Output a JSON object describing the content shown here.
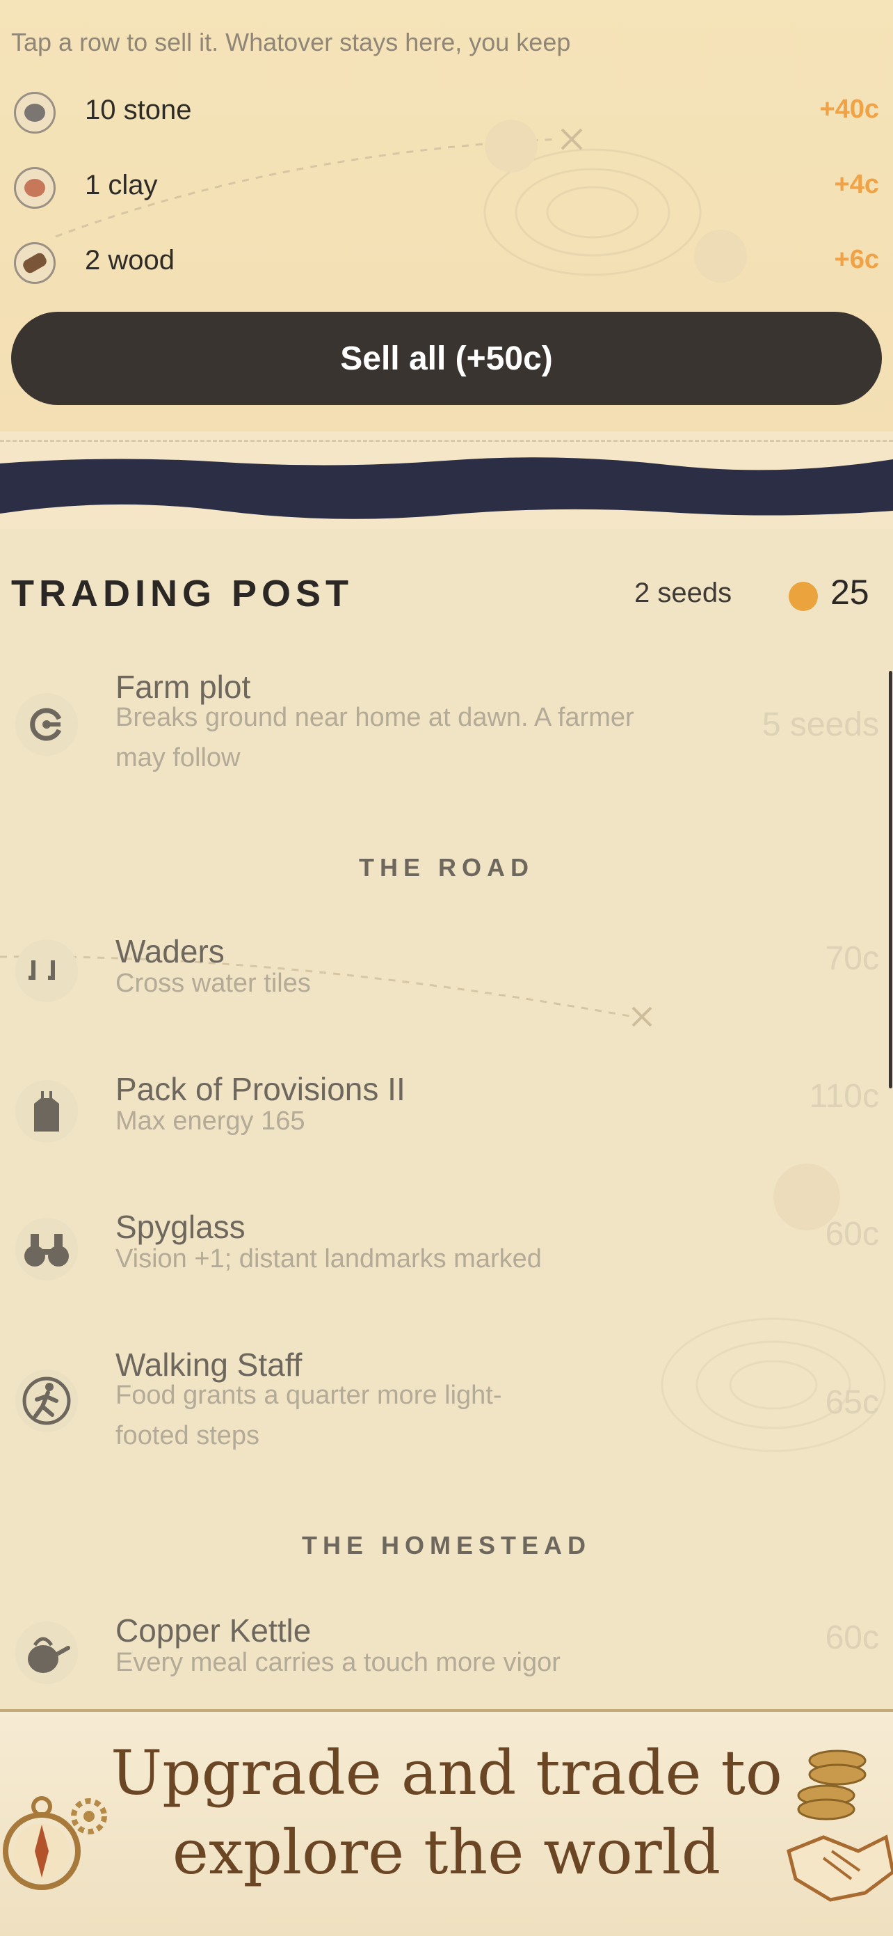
{
  "sell": {
    "hint": "Tap a row to sell it. Whatover stays here, you keep",
    "rows": [
      {
        "name": "10 stone",
        "price": "+40c",
        "icon": "stone-icon",
        "color": "#7b7671"
      },
      {
        "name": "1 clay",
        "price": "+4c",
        "icon": "clay-icon",
        "color": "#c8785a"
      },
      {
        "name": "2 wood",
        "price": "+6c",
        "icon": "wood-icon",
        "color": "#7a5537"
      }
    ],
    "sell_all_label": "Sell all (+50c)"
  },
  "shop": {
    "title": "TRADING POST",
    "seeds": "2 seeds",
    "coins": "25",
    "items": [
      {
        "name": "Farm plot",
        "desc": "Breaks ground near home at dawn. A farmer may follow",
        "price": "5 seeds",
        "icon": "farm-plot-icon"
      },
      {
        "name": "Waders",
        "desc": "Cross water tiles",
        "price": "70c",
        "icon": "waders-icon"
      },
      {
        "name": "Pack of Provisions II",
        "desc": "Max energy 165",
        "price": "110c",
        "icon": "backpack-icon"
      },
      {
        "name": "Spyglass",
        "desc": "Vision +1; distant landmarks marked",
        "price": "60c",
        "icon": "binoculars-icon"
      },
      {
        "name": "Walking Staff",
        "desc": "Food grants a quarter more light-footed steps",
        "price": "65c",
        "icon": "walker-icon"
      },
      {
        "name": "Copper Kettle",
        "desc": "Every meal carries a touch more vigor",
        "price": "60c",
        "icon": "kettle-icon"
      }
    ],
    "sections": [
      "THE ROAD",
      "THE HOMESTEAD"
    ]
  },
  "banner": {
    "line1": "Upgrade and trade to",
    "line2": "explore the world"
  },
  "colors": {
    "accent": "#eaa33d",
    "button": "#3a3430",
    "navy_band": "#2c2e45"
  }
}
